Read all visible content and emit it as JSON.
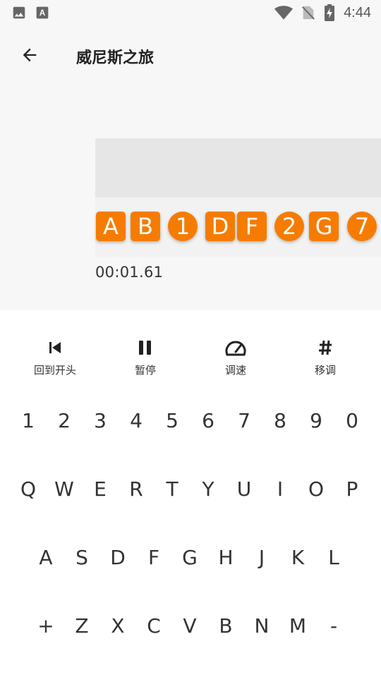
{
  "status_bar": {
    "time": "4:44",
    "icons_left": [
      "image-icon",
      "text-a-icon"
    ],
    "icons_right": [
      "wifi-icon",
      "no-sim-icon",
      "battery-charging-icon"
    ]
  },
  "app_bar": {
    "title": "威尼斯之旅",
    "back_icon": "arrow-left-icon"
  },
  "score": {
    "notes": [
      {
        "label": "A",
        "shape": "square"
      },
      {
        "label": "B",
        "shape": "square"
      },
      {
        "label": "1",
        "shape": "circle"
      },
      {
        "label": "D",
        "shape": "square"
      },
      {
        "label": "F",
        "shape": "square"
      },
      {
        "label": "2",
        "shape": "circle"
      },
      {
        "label": "G",
        "shape": "square"
      },
      {
        "label": "7",
        "shape": "circle"
      }
    ],
    "time": "00:01.61",
    "note_color": "#f57c00"
  },
  "controls": {
    "restart": {
      "label": "回到开头",
      "icon": "skip-previous-icon"
    },
    "pause": {
      "label": "暂停",
      "icon": "pause-icon"
    },
    "speed": {
      "label": "调速",
      "icon": "speedometer-icon"
    },
    "transpose": {
      "label": "移调",
      "icon": "sharp-icon"
    }
  },
  "keyboard": {
    "rows": [
      [
        "1",
        "2",
        "3",
        "4",
        "5",
        "6",
        "7",
        "8",
        "9",
        "0"
      ],
      [
        "Q",
        "W",
        "E",
        "R",
        "T",
        "Y",
        "U",
        "I",
        "O",
        "P"
      ],
      [
        "A",
        "S",
        "D",
        "F",
        "G",
        "H",
        "J",
        "K",
        "L"
      ],
      [
        "+",
        "Z",
        "X",
        "C",
        "V",
        "B",
        "N",
        "M",
        "-"
      ]
    ]
  }
}
